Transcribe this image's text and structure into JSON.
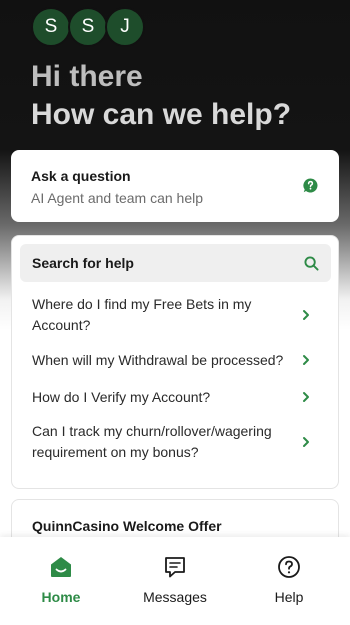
{
  "header": {
    "avatars": [
      "S",
      "S",
      "J"
    ],
    "greeting_line1": "Hi there",
    "greeting_line2": "How can we help?"
  },
  "ask": {
    "title": "Ask a question",
    "subtitle": "AI Agent and team can help",
    "icon": "question-bubble-icon"
  },
  "help": {
    "search_label": "Search for help",
    "articles": [
      "Where do I find my Free Bets in my Account?",
      "When will my Withdrawal be processed?",
      "How do I Verify my Account?",
      "Can I track my churn/rollover/wagering requirement on my bonus?"
    ]
  },
  "offer": {
    "title": "QuinnCasino Welcome Offer"
  },
  "tabs": [
    {
      "label": "Home",
      "icon": "home-icon",
      "active": true
    },
    {
      "label": "Messages",
      "icon": "messages-icon",
      "active": false
    },
    {
      "label": "Help",
      "icon": "help-icon",
      "active": false
    }
  ],
  "colors": {
    "accent": "#2e8b47",
    "avatar_bg": "#1e4d2b",
    "header_bg": "#111111"
  }
}
